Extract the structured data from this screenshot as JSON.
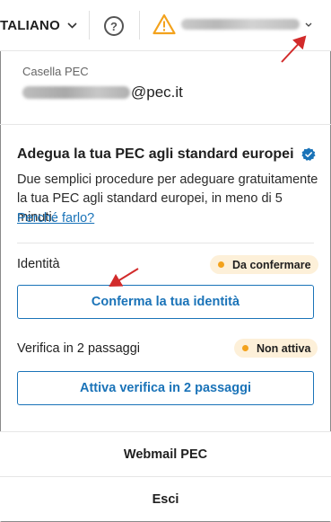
{
  "header": {
    "language_label": "TALIANO",
    "help_symbol": "?",
    "account_email_blurred": "sheldon.cooper@pec.it",
    "icons": [
      "chevron-down-icon",
      "help-circle-icon",
      "warning-triangle-icon",
      "chevron-down-icon"
    ],
    "warning_color": "#f3a21c"
  },
  "mailbox": {
    "label": "Casella PEC",
    "address_blurred_part": "sheldon.cooper",
    "address_domain": "@pec.it"
  },
  "adegua": {
    "title": "Adegua la tua PEC agli standard europei",
    "description": "Due semplici procedure per adeguare gratuitamente la tua PEC agli standard europei, in meno di 5 minuti.",
    "link": "Perché farlo?",
    "verified_icon": "verified-badge-icon",
    "accent_color": "#1a73b8"
  },
  "identity": {
    "label": "Identità",
    "status": "Da confermare",
    "button": "Conferma la tua identità"
  },
  "two_factor": {
    "label": "Verifica in 2 passaggi",
    "status": "Non attiva",
    "button": "Attiva verifica in 2 passaggi"
  },
  "menu": {
    "webmail": "Webmail PEC",
    "logout": "Esci"
  },
  "annotation_color": "#d22b2b"
}
